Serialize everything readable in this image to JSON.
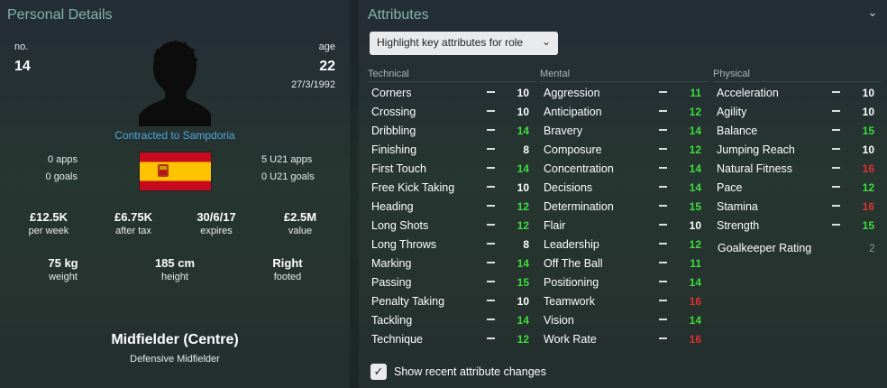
{
  "personal": {
    "title": "Personal Details",
    "number_label": "no.",
    "number": "14",
    "age_label": "age",
    "age": "22",
    "dob": "27/3/1992",
    "contract": "Contracted to Sampdoria",
    "apps": "0 apps",
    "goals": "0 goals",
    "u21_apps": "5 U21 apps",
    "u21_goals": "0 U21 goals",
    "money": [
      {
        "value": "£12.5K",
        "label": "per week"
      },
      {
        "value": "£6.75K",
        "label": "after tax"
      },
      {
        "value": "30/6/17",
        "label": "expires"
      },
      {
        "value": "£2.5M",
        "label": "value"
      }
    ],
    "physical": [
      {
        "value": "75 kg",
        "label": "weight"
      },
      {
        "value": "185 cm",
        "label": "height"
      },
      {
        "value": "Right",
        "label": "footed"
      }
    ],
    "position": "Midfielder (Centre)",
    "role": "Defensive Midfielder",
    "flag_colors": {
      "red": "#c60b1e",
      "yellow": "#ffc400"
    }
  },
  "attributes": {
    "title": "Attributes",
    "dropdown_label": "Highlight key attributes for role",
    "columns": {
      "technical": "Technical",
      "mental": "Mental",
      "physical": "Physical"
    },
    "technical": [
      {
        "name": "Corners",
        "value": "10",
        "color": "#ffffff"
      },
      {
        "name": "Crossing",
        "value": "10",
        "color": "#ffffff"
      },
      {
        "name": "Dribbling",
        "value": "14",
        "color": "#3ddc3d"
      },
      {
        "name": "Finishing",
        "value": "8",
        "color": "#ffffff"
      },
      {
        "name": "First Touch",
        "value": "14",
        "color": "#3ddc3d"
      },
      {
        "name": "Free Kick Taking",
        "value": "10",
        "color": "#ffffff"
      },
      {
        "name": "Heading",
        "value": "12",
        "color": "#3ddc3d"
      },
      {
        "name": "Long Shots",
        "value": "12",
        "color": "#3ddc3d"
      },
      {
        "name": "Long Throws",
        "value": "8",
        "color": "#ffffff"
      },
      {
        "name": "Marking",
        "value": "14",
        "color": "#3ddc3d"
      },
      {
        "name": "Passing",
        "value": "15",
        "color": "#3ddc3d"
      },
      {
        "name": "Penalty Taking",
        "value": "10",
        "color": "#ffffff"
      },
      {
        "name": "Tackling",
        "value": "14",
        "color": "#3ddc3d"
      },
      {
        "name": "Technique",
        "value": "12",
        "color": "#3ddc3d"
      }
    ],
    "mental": [
      {
        "name": "Aggression",
        "value": "11",
        "color": "#3ddc3d"
      },
      {
        "name": "Anticipation",
        "value": "12",
        "color": "#3ddc3d"
      },
      {
        "name": "Bravery",
        "value": "14",
        "color": "#3ddc3d"
      },
      {
        "name": "Composure",
        "value": "12",
        "color": "#3ddc3d"
      },
      {
        "name": "Concentration",
        "value": "14",
        "color": "#3ddc3d"
      },
      {
        "name": "Decisions",
        "value": "14",
        "color": "#3ddc3d"
      },
      {
        "name": "Determination",
        "value": "15",
        "color": "#3ddc3d"
      },
      {
        "name": "Flair",
        "value": "10",
        "color": "#ffffff"
      },
      {
        "name": "Leadership",
        "value": "12",
        "color": "#3ddc3d"
      },
      {
        "name": "Off The Ball",
        "value": "11",
        "color": "#3ddc3d"
      },
      {
        "name": "Positioning",
        "value": "14",
        "color": "#3ddc3d"
      },
      {
        "name": "Teamwork",
        "value": "16",
        "color": "#e03030"
      },
      {
        "name": "Vision",
        "value": "14",
        "color": "#3ddc3d"
      },
      {
        "name": "Work Rate",
        "value": "16",
        "color": "#e03030"
      }
    ],
    "physical": [
      {
        "name": "Acceleration",
        "value": "10",
        "color": "#ffffff"
      },
      {
        "name": "Agility",
        "value": "10",
        "color": "#ffffff"
      },
      {
        "name": "Balance",
        "value": "15",
        "color": "#3ddc3d"
      },
      {
        "name": "Jumping Reach",
        "value": "10",
        "color": "#ffffff"
      },
      {
        "name": "Natural Fitness",
        "value": "16",
        "color": "#e03030"
      },
      {
        "name": "Pace",
        "value": "12",
        "color": "#3ddc3d"
      },
      {
        "name": "Stamina",
        "value": "16",
        "color": "#e03030"
      },
      {
        "name": "Strength",
        "value": "15",
        "color": "#3ddc3d"
      }
    ],
    "goalkeeper_label": "Goalkeeper Rating",
    "goalkeeper_value": "2",
    "checkbox_label": "Show recent attribute changes",
    "checkbox_checked": true
  }
}
